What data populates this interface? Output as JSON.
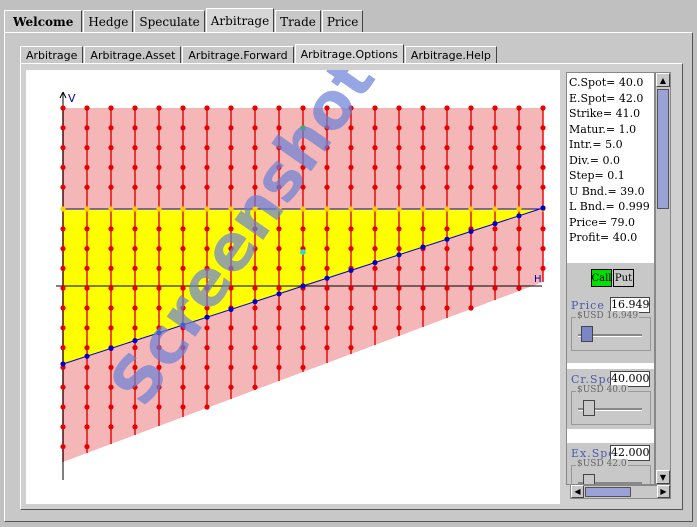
{
  "top_tabs": [
    "Welcome",
    "Hedge",
    "Speculate",
    "Arbitrage",
    "Trade",
    "Price"
  ],
  "sub_tabs": [
    "Arbitrage",
    "Arbitrage.Asset",
    "Arbitrage.Forward",
    "Arbitrage.Options",
    "Arbitrage.Help"
  ],
  "params": [
    "C.Spot= 40.0",
    "E.Spot= 42.0",
    "Strike= 41.0",
    "Matur.= 1.0",
    "Intr.= 5.0",
    "Div.= 0.0",
    "Step= 0.1",
    "U Bnd.= 39.0",
    "L Bnd.= 0.999",
    "Price= 79.0",
    "Profit= 40.0"
  ],
  "buttons": {
    "call": "Call",
    "put": "Put"
  },
  "controls": [
    {
      "label": "Price",
      "value": "16.949",
      "group": "$USD 16.949",
      "level": 0.05
    },
    {
      "label": "Cr.Spot",
      "value": "40.000",
      "group": "$USD 40.0",
      "level": 0.1
    },
    {
      "label": "Ex.Spot",
      "value": "42.000",
      "group": "$USD 42.0",
      "level": 0.1
    }
  ],
  "chart": {
    "y_axis_label": "V",
    "x_axis_label": "H"
  },
  "watermark": "Screenshot",
  "colors": {
    "grid_dots": "#e60000",
    "yellow_region": "#ffff00",
    "pink_region": "#f4b6b6",
    "line": "#0000cc",
    "watermark": "#6a80d8"
  }
}
